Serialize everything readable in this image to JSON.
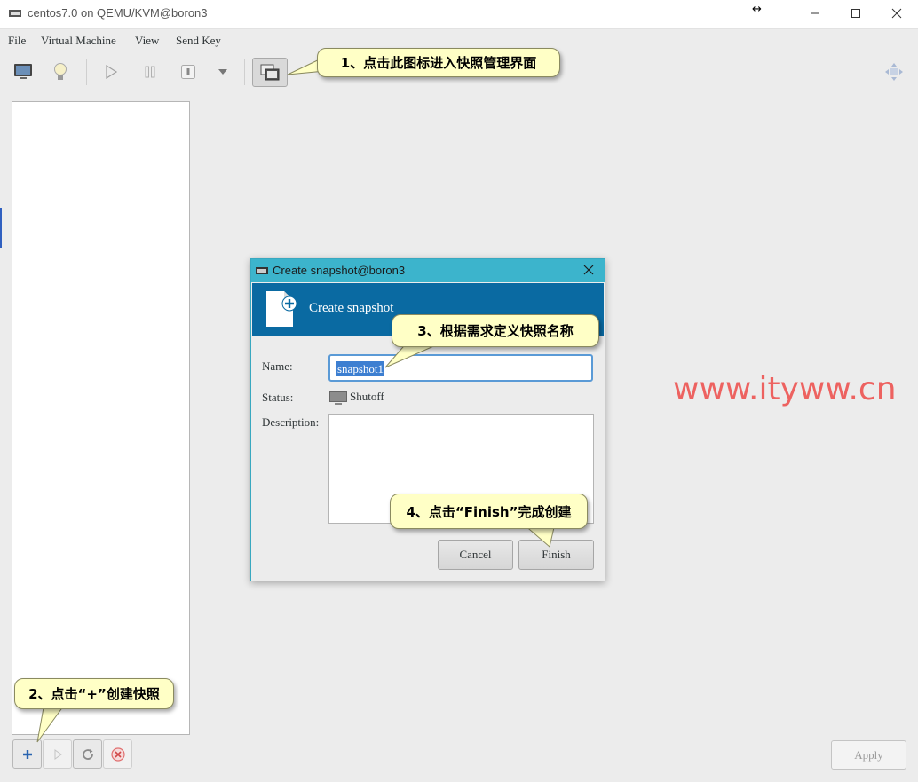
{
  "window": {
    "title": "centos7.0 on QEMU/KVM@boron3",
    "resize_indicator": "↔"
  },
  "menu": [
    "File",
    "Virtual Machine",
    "View",
    "Send Key"
  ],
  "toolbar": {
    "icons": [
      "console-icon",
      "details-icon",
      "run-icon",
      "pause-icon",
      "shutdown-icon",
      "dropdown-icon",
      "snapshot-manager-icon",
      "fullscreen-icon"
    ]
  },
  "bottom_bar": {
    "apply_label": "Apply"
  },
  "dialog": {
    "title": "Create snapshot@boron3",
    "header": "Create snapshot",
    "name_label": "Name:",
    "name_value": "snapshot1",
    "status_label": "Status:",
    "status_value": "Shutoff",
    "description_label": "Description:",
    "description_value": "",
    "cancel_label": "Cancel",
    "finish_label": "Finish"
  },
  "callouts": {
    "step1": "1、点击此图标进入快照管理界面",
    "step2": "2、点击“+”创建快照",
    "step3": "3、根据需求定义快照名称",
    "step4": "4、点击“Finish”完成创建"
  },
  "watermark": "www.ityww.cn",
  "colors": {
    "dialog_title": "#3cb4cc",
    "dialog_header": "#0a6aa2",
    "callout": "#ffffc6",
    "watermark": "#ee4b48"
  }
}
